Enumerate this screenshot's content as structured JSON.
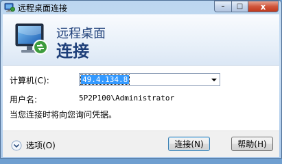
{
  "window": {
    "title": "远程桌面连接",
    "controls": {
      "minimize": "–",
      "maximize": "□",
      "close": "x"
    }
  },
  "banner": {
    "line1": "远程桌面",
    "line2": "连接"
  },
  "form": {
    "computer_label": "计算机(C):",
    "computer_value": "49.4.134.8",
    "username_label": "用户名:",
    "username_value": "5P2P100\\Administrator",
    "info_text": "当您连接时将向您询问凭据。"
  },
  "footer": {
    "options_label": "选项(O)",
    "connect_label": "连接(N)",
    "help_label": "帮助(H)"
  },
  "icons": {
    "title": "remote-desktop-icon",
    "banner": "monitor-connection-icon",
    "options": "chevron-down-icon",
    "combo": "dropdown-arrow-icon"
  },
  "colors": {
    "accent": "#1e3f79",
    "selection": "#3399ff",
    "close": "#c7432a"
  }
}
